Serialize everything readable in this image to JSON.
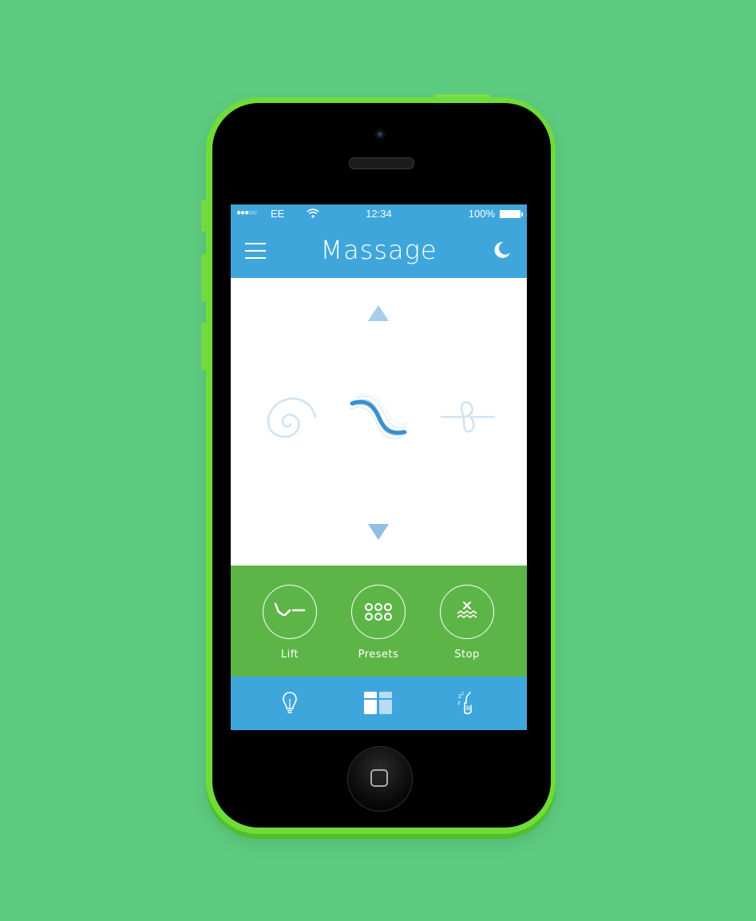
{
  "status_bar": {
    "signal": "●●●○○",
    "carrier": "EE",
    "time": "12:34",
    "battery": "100%"
  },
  "nav": {
    "title": "Massage",
    "menu_icon": "hamburger-menu-icon",
    "right_icon": "moon-icon"
  },
  "massage_modes": [
    {
      "icon": "spiral-icon",
      "active": false
    },
    {
      "icon": "wave-icon",
      "active": true
    },
    {
      "icon": "loop-icon",
      "active": false
    }
  ],
  "actions": [
    {
      "label": "Lift",
      "icon": "lift-icon"
    },
    {
      "label": "Presets",
      "icon": "presets-icon"
    },
    {
      "label": "Stop",
      "icon": "stop-icon"
    }
  ],
  "tabs": [
    {
      "icon": "lightbulb-icon",
      "active": false
    },
    {
      "icon": "massage-panel-icon",
      "active": true
    },
    {
      "icon": "sleep-icon",
      "active": false
    }
  ],
  "colors": {
    "background": "#5ecc80",
    "phone_body": "#6fdc3a",
    "header_blue": "#3fa6dc",
    "action_green": "#5db547",
    "light_blue": "#a6cde9"
  }
}
